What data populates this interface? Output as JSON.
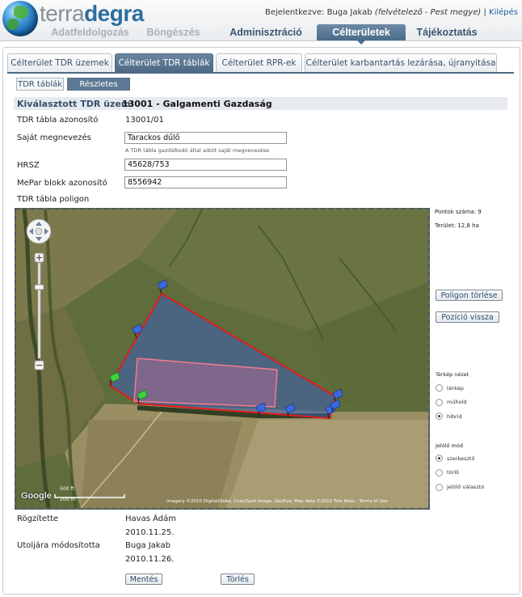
{
  "brand": {
    "logo_part1": "terra",
    "logo_part2": "degra"
  },
  "user_bar": {
    "prefix": "Bejelentkezve:",
    "name": "Buga Jakab",
    "role": "(felvételező - Pest megye)",
    "separator": "|",
    "logout": "Kilépés"
  },
  "top_nav": [
    "Adatfeldolgozás",
    "Böngészés",
    "Adminisztráció",
    "Célterületek",
    "Tájékoztatás"
  ],
  "tabs": [
    "Célterület TDR üzemek",
    "Célterület TDR táblák",
    "Célterület RPR-ek",
    "Célterület karbantartás lezárása, újranyitása"
  ],
  "subtabs": [
    "TDR táblák",
    "Részletes nézet"
  ],
  "selected": {
    "label": "Kiválasztott TDR üzem:",
    "value": "13001 - Galgamenti Gazdaság"
  },
  "form": {
    "id_label": "TDR tábla azonosító",
    "id_value": "13001/01",
    "name_label": "Saját megnevezés",
    "name_value": "Tarackos dűlő",
    "name_hint": "A TDR tábla gazdálkodó által adott saját megnevezése",
    "hrsz_label": "HRSZ",
    "hrsz_value": "45628/753",
    "mepar_label": "MePar blokk azonosító",
    "mepar_value": "8556942",
    "polygon_label": "TDR tábla poligon"
  },
  "map": {
    "attribution": "Imagery ©2010 DigitalGlobe, Cnes/Spot Image, GeoEye, Map data ©2010 Tele Atlas - Terms of Use",
    "scale_top": "500 ft",
    "scale_bottom": "200 m",
    "google": "Google"
  },
  "side": {
    "points": "Pontok száma: 9",
    "area": "Terület: 12,8 ha",
    "delete_polygon": "Poligon törlése",
    "reset_position": "Pozíció vissza",
    "map_view_title": "Térkép nézet",
    "map_views": [
      {
        "label": "térkép",
        "selected": false
      },
      {
        "label": "műhold",
        "selected": false
      },
      {
        "label": "hibrid",
        "selected": true
      }
    ],
    "marker_mode_title": "Jelölő mód",
    "marker_modes": [
      {
        "label": "szerkesztő",
        "selected": true
      },
      {
        "label": "törlő",
        "selected": false
      },
      {
        "label": "jelölő választó",
        "selected": false
      }
    ]
  },
  "meta": {
    "recorded_label": "Rögzítette",
    "recorded_by": "Havas Ádám",
    "recorded_date": "2010.11.25.",
    "modified_label": "Utoljára módosította",
    "modified_by": "Buga Jakab",
    "modified_date": "2010.11.26."
  },
  "buttons": {
    "save": "Mentés",
    "delete": "Törlés"
  }
}
